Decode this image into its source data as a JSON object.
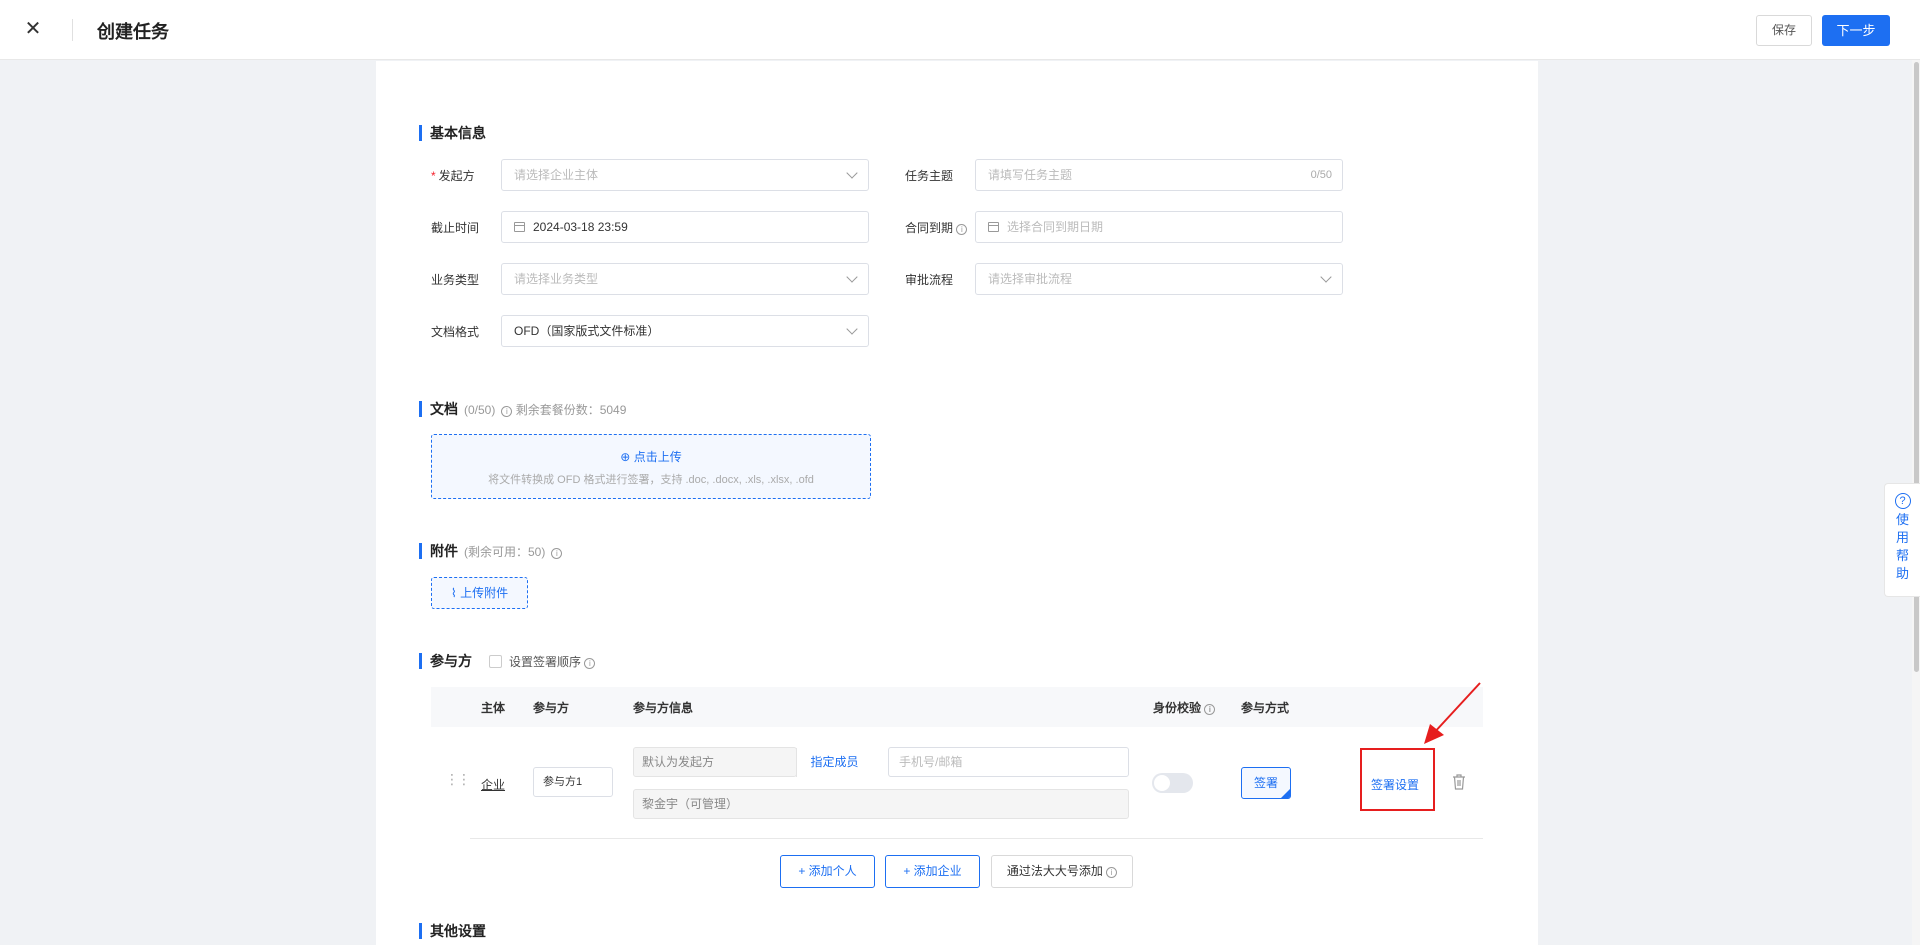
{
  "header": {
    "close": "✕",
    "title": "创建任务",
    "save": "保存",
    "next": "下一步"
  },
  "basic": {
    "title": "基本信息",
    "initiator": {
      "label": "发起方",
      "placeholder": "请选择企业主体"
    },
    "subject": {
      "label": "任务主题",
      "placeholder": "请填写任务主题",
      "counter": "0/50"
    },
    "deadline": {
      "label": "截止时间",
      "value": "2024-03-18 23:59"
    },
    "contract_due": {
      "label": "合同到期",
      "placeholder": "选择合同到期日期"
    },
    "biz_type": {
      "label": "业务类型",
      "placeholder": "请选择业务类型"
    },
    "approval": {
      "label": "审批流程",
      "placeholder": "请选择审批流程"
    },
    "doc_format": {
      "label": "文档格式",
      "value": "OFD（国家版式文件标准）"
    }
  },
  "docs": {
    "title": "文档",
    "count": "(0/50)",
    "remaining": "剩余套餐份数：5049",
    "upload_link": "点击上传",
    "upload_hint": "将文件转换成 OFD 格式进行签署，支持 .doc, .docx, .xls, .xlsx, .ofd"
  },
  "attach": {
    "title": "附件",
    "note": "(剩余可用：50)",
    "button": "上传附件"
  },
  "parties": {
    "title": "参与方",
    "order_label": "设置签署顺序",
    "columns": {
      "subject": "主体",
      "party": "参与方",
      "info": "参与方信息",
      "verify": "身份校验",
      "mode": "参与方式"
    },
    "row": {
      "entity": "企业",
      "name": "参与方1",
      "default_initiator": "默认为发起方",
      "assign": "指定成员",
      "phone_placeholder": "手机号/邮箱",
      "member": "黎金宇（可管理）",
      "mode": "签署",
      "settings": "签署设置"
    },
    "add_person": "+ 添加个人",
    "add_company": "+ 添加企业",
    "add_legal": "通过法大大号添加"
  },
  "other": {
    "title": "其他设置"
  },
  "help": {
    "q": "?",
    "chars": [
      "使",
      "用",
      "帮",
      "助"
    ]
  },
  "colors": {
    "accent": "#1d6ff2",
    "highlight": "#e61e1e"
  }
}
